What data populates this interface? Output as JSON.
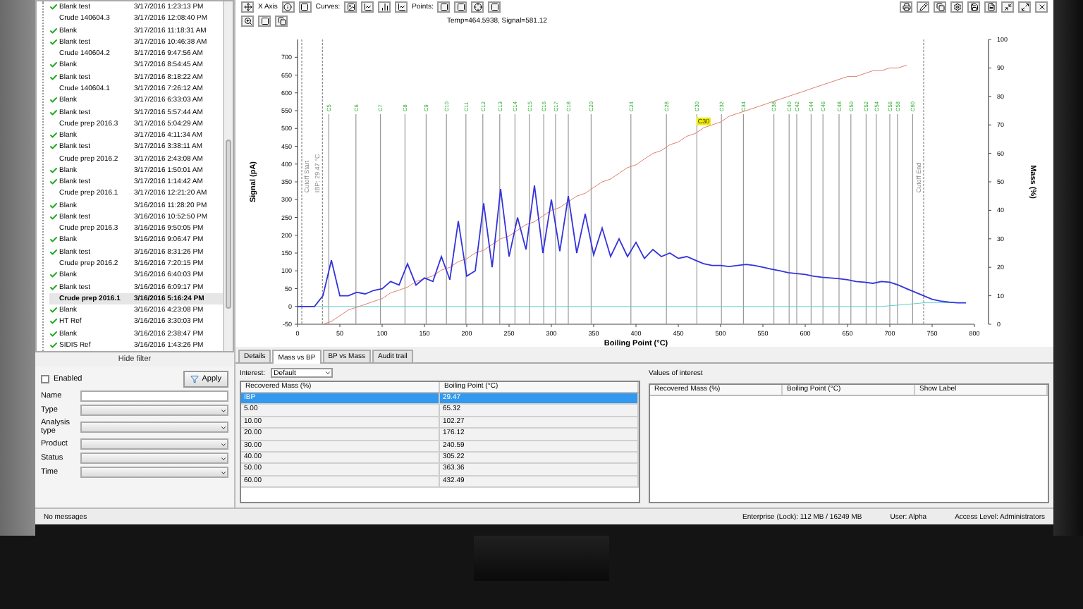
{
  "samples": [
    {
      "name": "Blank test",
      "date": "3/17/2016 1:23:13 PM",
      "checked": true,
      "selected": false
    },
    {
      "name": "Crude 140604.3",
      "date": "3/17/2016 12:08:40 PM",
      "checked": false,
      "selected": false
    },
    {
      "name": "Blank",
      "date": "3/17/2016 11:18:31 AM",
      "checked": true,
      "selected": false
    },
    {
      "name": "Blank test",
      "date": "3/17/2016 10:46:38 AM",
      "checked": true,
      "selected": false
    },
    {
      "name": "Crude 140604.2",
      "date": "3/17/2016 9:47:56 AM",
      "checked": false,
      "selected": false
    },
    {
      "name": "Blank",
      "date": "3/17/2016 8:54:45 AM",
      "checked": true,
      "selected": false
    },
    {
      "name": "Blank test",
      "date": "3/17/2016 8:18:22 AM",
      "checked": true,
      "selected": false
    },
    {
      "name": "Crude 140604.1",
      "date": "3/17/2016 7:26:12 AM",
      "checked": false,
      "selected": false
    },
    {
      "name": "Blank",
      "date": "3/17/2016 6:33:03 AM",
      "checked": true,
      "selected": false
    },
    {
      "name": "Blank test",
      "date": "3/17/2016 5:57:44 AM",
      "checked": true,
      "selected": false
    },
    {
      "name": "Crude prep 2016.3",
      "date": "3/17/2016 5:04:29 AM",
      "checked": false,
      "selected": false
    },
    {
      "name": "Blank",
      "date": "3/17/2016 4:11:34 AM",
      "checked": true,
      "selected": false
    },
    {
      "name": "Blank test",
      "date": "3/17/2016 3:38:11 AM",
      "checked": true,
      "selected": false
    },
    {
      "name": "Crude prep 2016.2",
      "date": "3/17/2016 2:43:08 AM",
      "checked": false,
      "selected": false
    },
    {
      "name": "Blank",
      "date": "3/17/2016 1:50:01 AM",
      "checked": true,
      "selected": false
    },
    {
      "name": "Blank test",
      "date": "3/17/2016 1:14:42 AM",
      "checked": true,
      "selected": false
    },
    {
      "name": "Crude prep 2016.1",
      "date": "3/17/2016 12:21:20 AM",
      "checked": false,
      "selected": false
    },
    {
      "name": "Blank",
      "date": "3/16/2016 11:28:20 PM",
      "checked": true,
      "selected": false
    },
    {
      "name": "Blank test",
      "date": "3/16/2016 10:52:50 PM",
      "checked": true,
      "selected": false
    },
    {
      "name": "Crude prep 2016.3",
      "date": "3/16/2016 9:50:05 PM",
      "checked": false,
      "selected": false
    },
    {
      "name": "Blank",
      "date": "3/16/2016 9:06:47 PM",
      "checked": true,
      "selected": false
    },
    {
      "name": "Blank test",
      "date": "3/16/2016 8:31:26 PM",
      "checked": true,
      "selected": false
    },
    {
      "name": "Crude prep 2016.2",
      "date": "3/16/2016 7:20:15 PM",
      "checked": false,
      "selected": false
    },
    {
      "name": "Blank",
      "date": "3/16/2016 6:40:03 PM",
      "checked": true,
      "selected": false
    },
    {
      "name": "Blank test",
      "date": "3/16/2016 6:09:17 PM",
      "checked": true,
      "selected": false
    },
    {
      "name": "Crude prep 2016.1",
      "date": "3/16/2016 5:16:24 PM",
      "checked": false,
      "selected": true
    },
    {
      "name": "Blank",
      "date": "3/16/2016 4:23:08 PM",
      "checked": true,
      "selected": false
    },
    {
      "name": "HT Ref",
      "date": "3/16/2016 3:30:03 PM",
      "checked": true,
      "selected": false
    },
    {
      "name": "Blank",
      "date": "3/16/2016 2:38:47 PM",
      "checked": true,
      "selected": false
    },
    {
      "name": "SIDIS Ref",
      "date": "3/16/2016 1:43:26 PM",
      "checked": true,
      "selected": false
    }
  ],
  "filter": {
    "title": "Hide filter",
    "enabled": {
      "label": "Enabled",
      "checked": false
    },
    "apply": "Apply",
    "fields": [
      {
        "label": "Name",
        "kind": "text"
      },
      {
        "label": "Type",
        "kind": "select"
      },
      {
        "label": "Analysis type",
        "kind": "select"
      },
      {
        "label": "Product",
        "kind": "select"
      },
      {
        "label": "Status",
        "kind": "select"
      },
      {
        "label": "Time",
        "kind": "select"
      }
    ]
  },
  "toolbar": {
    "x_axis": "X Axis",
    "curves": "Curves:",
    "points": "Points:",
    "readout": "Temp=464.5938, Signal=581.12"
  },
  "chart_data": {
    "type": "line",
    "xlabel": "Boiling Point (°C)",
    "ylabel": "Signal (pA)",
    "y2label": "Mass (%)",
    "xlim": [
      0,
      800
    ],
    "ylim": [
      -50,
      750
    ],
    "y2lim": [
      0,
      100
    ],
    "xticks": [
      0,
      50,
      100,
      150,
      200,
      250,
      300,
      350,
      400,
      450,
      500,
      550,
      600,
      650,
      700,
      750,
      800
    ],
    "yticks": [
      -50,
      0,
      50,
      100,
      150,
      200,
      250,
      300,
      350,
      400,
      450,
      500,
      550,
      600,
      650,
      700
    ],
    "y2ticks": [
      0,
      10,
      20,
      30,
      40,
      50,
      60,
      70,
      80,
      90,
      100
    ],
    "x": [
      0,
      10,
      20,
      30,
      40,
      50,
      60,
      70,
      80,
      90,
      100,
      110,
      120,
      130,
      140,
      150,
      160,
      170,
      180,
      190,
      200,
      210,
      220,
      230,
      240,
      250,
      260,
      270,
      280,
      290,
      300,
      310,
      320,
      330,
      340,
      350,
      360,
      370,
      380,
      390,
      400,
      410,
      420,
      430,
      440,
      450,
      460,
      470,
      480,
      490,
      500,
      510,
      520,
      530,
      540,
      550,
      560,
      570,
      580,
      590,
      600,
      610,
      620,
      630,
      640,
      650,
      660,
      670,
      680,
      690,
      700,
      710,
      720,
      730,
      740,
      750,
      760,
      770,
      780,
      790
    ],
    "series": [
      {
        "color": "#3333dd",
        "values": [
          0,
          0,
          0,
          30,
          130,
          30,
          30,
          40,
          35,
          45,
          50,
          70,
          60,
          120,
          60,
          80,
          70,
          140,
          75,
          240,
          85,
          100,
          290,
          110,
          330,
          140,
          250,
          160,
          340,
          150,
          300,
          155,
          310,
          150,
          260,
          145,
          220,
          140,
          190,
          140,
          180,
          135,
          160,
          140,
          150,
          135,
          140,
          130,
          120,
          115,
          115,
          112,
          115,
          118,
          115,
          110,
          105,
          100,
          95,
          92,
          90,
          85,
          82,
          80,
          78,
          75,
          70,
          68,
          65,
          70,
          68,
          60,
          50,
          40,
          30,
          20,
          15,
          12,
          10,
          10
        ]
      },
      {
        "color": "#e08070",
        "axis": "y2",
        "values": [
          null,
          null,
          null,
          0,
          1,
          3,
          5,
          6,
          7,
          8,
          9,
          11,
          12,
          13,
          15,
          16,
          17,
          19,
          20,
          22,
          23,
          25,
          26,
          28,
          30,
          31,
          33,
          35,
          36,
          38,
          40,
          41,
          43,
          45,
          46,
          48,
          50,
          51,
          53,
          55,
          56,
          58,
          60,
          61,
          63,
          64,
          66,
          67,
          69,
          70,
          71,
          73,
          74,
          75,
          76,
          77,
          78,
          79,
          80,
          81,
          82,
          83,
          84,
          85,
          86,
          87,
          87,
          88,
          89,
          89,
          90,
          90,
          91,
          null,
          null,
          null,
          null,
          null,
          null,
          null
        ]
      },
      {
        "color": "#66cccc",
        "values": [
          0,
          0,
          0,
          0,
          0,
          0,
          0,
          0,
          0,
          0,
          0,
          0,
          0,
          0,
          0,
          0,
          0,
          0,
          0,
          0,
          0,
          0,
          0,
          0,
          0,
          0,
          0,
          0,
          0,
          0,
          0,
          0,
          0,
          0,
          0,
          0,
          0,
          0,
          0,
          0,
          0,
          0,
          0,
          0,
          0,
          0,
          0,
          0,
          0,
          0,
          0,
          0,
          0,
          0,
          0,
          0,
          0,
          0,
          0,
          0,
          0,
          0,
          0,
          0,
          0,
          0,
          0,
          0,
          0,
          0,
          2,
          4,
          6,
          8,
          10,
          10,
          10,
          10,
          10,
          10
        ]
      }
    ],
    "ref_lines": [
      {
        "axis": "x",
        "value": 5,
        "label": "Cutoff Start"
      },
      {
        "axis": "x",
        "value": 29.47,
        "label": "IBP: 29.47 °C"
      },
      {
        "axis": "x",
        "value": 740,
        "label": "Cutoff End"
      },
      {
        "axis": "x",
        "value": 37,
        "label": "C5"
      },
      {
        "axis": "x",
        "value": 69,
        "label": "C6"
      },
      {
        "axis": "x",
        "value": 98,
        "label": "C7"
      },
      {
        "axis": "x",
        "value": 127,
        "label": "C8"
      },
      {
        "axis": "x",
        "value": 152,
        "label": "C9"
      },
      {
        "axis": "x",
        "value": 176,
        "label": "C10"
      },
      {
        "axis": "x",
        "value": 199,
        "label": "C11"
      },
      {
        "axis": "x",
        "value": 219,
        "label": "C12"
      },
      {
        "axis": "x",
        "value": 239,
        "label": "C13"
      },
      {
        "axis": "x",
        "value": 257,
        "label": "C14"
      },
      {
        "axis": "x",
        "value": 274,
        "label": "C15"
      },
      {
        "axis": "x",
        "value": 291,
        "label": "C16"
      },
      {
        "axis": "x",
        "value": 305,
        "label": "C17"
      },
      {
        "axis": "x",
        "value": 320,
        "label": "C18"
      },
      {
        "axis": "x",
        "value": 347,
        "label": "C20"
      },
      {
        "axis": "x",
        "value": 394,
        "label": "C24"
      },
      {
        "axis": "x",
        "value": 436,
        "label": "C28"
      },
      {
        "axis": "x",
        "value": 472,
        "label": "C30"
      },
      {
        "axis": "x",
        "value": 501,
        "label": "C32"
      },
      {
        "axis": "x",
        "value": 527,
        "label": "C34"
      },
      {
        "axis": "x",
        "value": 563,
        "label": "C38"
      },
      {
        "axis": "x",
        "value": 581,
        "label": "C40"
      },
      {
        "axis": "x",
        "value": 590,
        "label": "C42"
      },
      {
        "axis": "x",
        "value": 607,
        "label": "C44"
      },
      {
        "axis": "x",
        "value": 621,
        "label": "C46"
      },
      {
        "axis": "x",
        "value": 640,
        "label": "C48"
      },
      {
        "axis": "x",
        "value": 654,
        "label": "C50"
      },
      {
        "axis": "x",
        "value": 672,
        "label": "C52"
      },
      {
        "axis": "x",
        "value": 684,
        "label": "C54"
      },
      {
        "axis": "x",
        "value": 700,
        "label": "C56"
      },
      {
        "axis": "x",
        "value": 709,
        "label": "C58"
      },
      {
        "axis": "x",
        "value": 727,
        "label": "C60"
      }
    ],
    "annotations": [
      {
        "x": 480,
        "y": 515,
        "text": "C30"
      }
    ]
  },
  "tabs": [
    {
      "label": "Details",
      "selected": false
    },
    {
      "label": "Mass vs BP",
      "selected": true
    },
    {
      "label": "BP vs Mass",
      "selected": false
    },
    {
      "label": "Audit trail",
      "selected": false
    }
  ],
  "interest": {
    "label": "Interest:",
    "value": "Default"
  },
  "mass_table": {
    "columns": [
      "Recovered Mass (%)",
      "Boiling Point (°C)"
    ],
    "rows": [
      {
        "cells": [
          "IBP",
          "29.47"
        ],
        "selected": true
      },
      {
        "cells": [
          "5.00",
          "65.32"
        ],
        "selected": false
      },
      {
        "cells": [
          "10.00",
          "102.27"
        ],
        "selected": false
      },
      {
        "cells": [
          "20.00",
          "176.12"
        ],
        "selected": false
      },
      {
        "cells": [
          "30.00",
          "240.59"
        ],
        "selected": false
      },
      {
        "cells": [
          "40.00",
          "305.22"
        ],
        "selected": false
      },
      {
        "cells": [
          "50.00",
          "363.36"
        ],
        "selected": false
      },
      {
        "cells": [
          "60.00",
          "432.49"
        ],
        "selected": false
      }
    ]
  },
  "values_of_interest": {
    "title": "Values of interest",
    "columns": [
      "Recovered Mass (%)",
      "Boiling Point (°C)",
      "Show Label"
    ]
  },
  "status_bar": {
    "message": "No messages",
    "memory": "Enterprise (Lock): 112 MB / 16249 MB",
    "user": "User: Alpha",
    "access": "Access Level: Administrators"
  }
}
